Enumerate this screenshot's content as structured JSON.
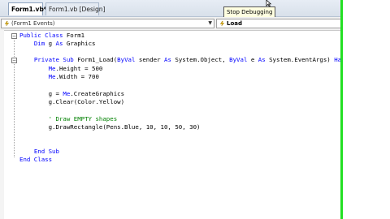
{
  "tabs": [
    {
      "label": "Form1.vb*",
      "active": true
    },
    {
      "label": "Form1.vb [Design]",
      "active": false
    }
  ],
  "tooltip": "Stop Debugging",
  "dropdowns": {
    "left": "(Form1 Events)",
    "right": "Load"
  },
  "code_lines": [
    "Public Class Form1",
    "    Dim g As Graphics",
    "",
    "    Private Sub Form1_Load(ByVal sender As System.Object, ByVal e As System.EventArgs) Han",
    "        Me.Height = 500",
    "        Me.Width = 700",
    "",
    "        g = Me.CreateGraphics",
    "        g.Clear(Color.Yellow)",
    "",
    "        ' Draw EMPTY shapes",
    "        g.DrawRectangle(Pens.Blue, 10, 10, 50, 30)",
    "",
    "",
    "    End Sub",
    "End Class"
  ],
  "colors": {
    "keyword": "#0000ff",
    "comment": "#008000",
    "highlight_border": "#22e022"
  }
}
